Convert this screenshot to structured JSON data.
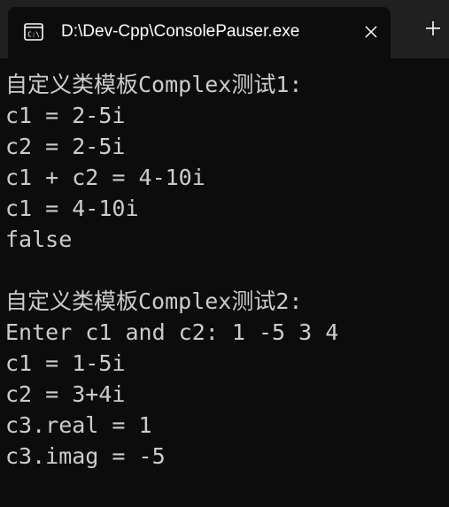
{
  "tab": {
    "title": "D:\\Dev-Cpp\\ConsolePauser.exe",
    "icon": "console-app-icon"
  },
  "new_tab_icon": "plus-icon",
  "close_icon": "close-icon",
  "console": {
    "lines": [
      "自定义类模板Complex测试1:",
      "c1 = 2-5i",
      "c2 = 2-5i",
      "c1 + c2 = 4-10i",
      "c1 = 4-10i",
      "false",
      "",
      "自定义类模板Complex测试2:",
      "Enter c1 and c2: 1 -5 3 4",
      "c1 = 1-5i",
      "c2 = 3+4i",
      "c3.real = 1",
      "c3.imag = -5"
    ]
  },
  "colors": {
    "background": "#0c0c0c",
    "tabbar": "#202020",
    "text": "#cccccc"
  }
}
